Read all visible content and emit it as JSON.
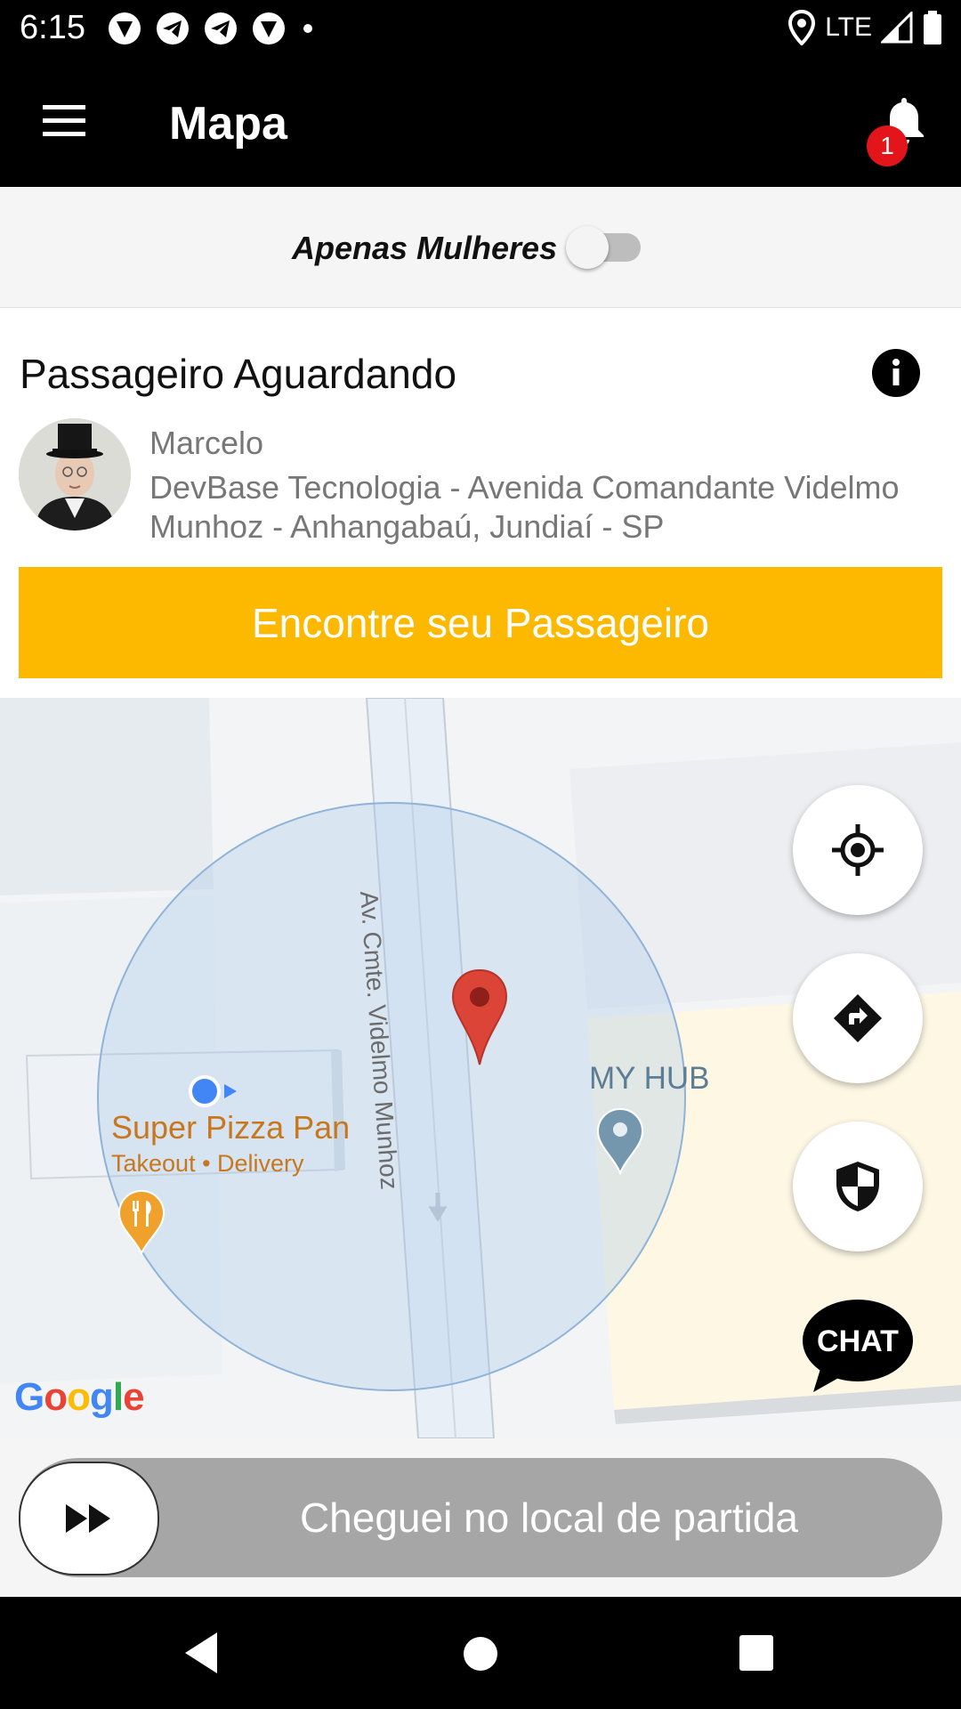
{
  "status_bar": {
    "time": "6:15",
    "network": "LTE",
    "icons_left": [
      "vpn-icon",
      "telegram-icon",
      "telegram-icon",
      "vpn-icon",
      "dot-icon"
    ],
    "icons_right": [
      "location-icon",
      "signal-icon",
      "battery-icon"
    ]
  },
  "app_bar": {
    "title": "Mapa",
    "notification_count": "1"
  },
  "filter": {
    "women_only_label": "Apenas Mulheres",
    "women_only_enabled": false
  },
  "card": {
    "title": "Passageiro Aguardando",
    "passenger_name": "Marcelo",
    "passenger_address": "DevBase Tecnologia - Avenida Comandante Videlmo Munhoz - Anhangabaú, Jundiaí - SP",
    "find_button_label": "Encontre seu Passageiro"
  },
  "map": {
    "street_label": "Av. Cmte. Videlmo Munhoz",
    "poi_name": "Super Pizza Pan",
    "poi_subtitle": "Takeout • Delivery",
    "place_label": "MY HUB",
    "attribution": "Google",
    "buttons": [
      "locate-icon",
      "directions-icon",
      "shield-icon",
      "chat-icon"
    ],
    "chat_label": "CHAT"
  },
  "bottom": {
    "slide_label": "Cheguei no local de partida"
  },
  "colors": {
    "accent": "#fdb900",
    "badge": "#e3151a",
    "marker": "#db4437"
  }
}
